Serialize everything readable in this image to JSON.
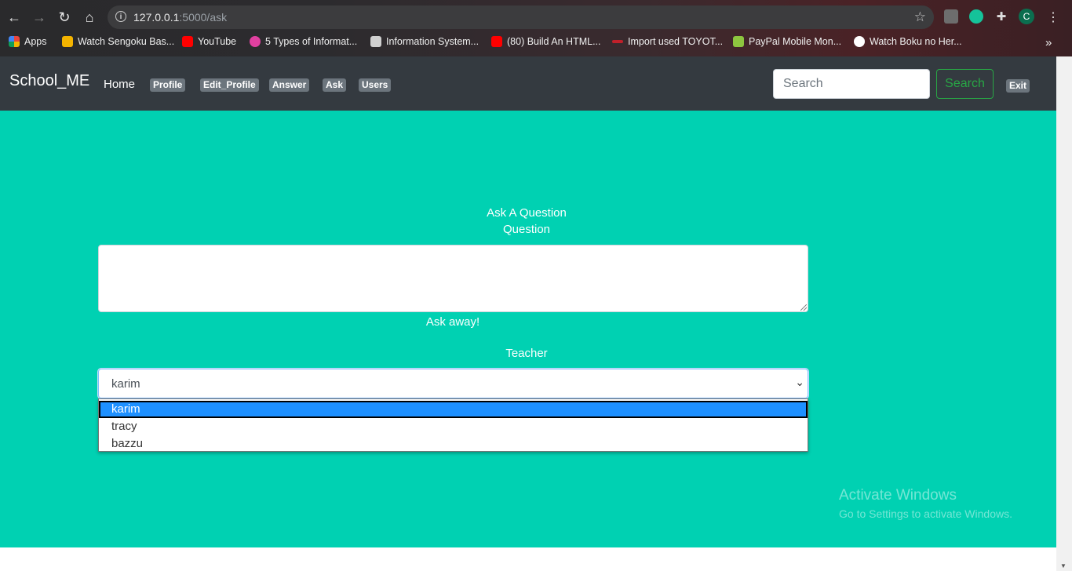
{
  "browser": {
    "url_host": "127.0.0.1",
    "url_path": ":5000/ask",
    "profile_initial": "C",
    "bookmarks": [
      {
        "label": "Apps",
        "icon": "apps-grid-icon",
        "color": "#e8453c"
      },
      {
        "label": "Watch Sengoku Bas...",
        "icon": "site-icon",
        "color": "#f4b400"
      },
      {
        "label": "YouTube",
        "icon": "youtube-icon",
        "color": "#ff0000"
      },
      {
        "label": "5 Types of Informat...",
        "icon": "site-icon",
        "color": "#e040a0"
      },
      {
        "label": "Information System...",
        "icon": "site-icon",
        "color": "#d0d0d0"
      },
      {
        "label": "(80) Build An HTML...",
        "icon": "youtube-icon",
        "color": "#ff0000"
      },
      {
        "label": "Import used TOYOT...",
        "icon": "site-icon",
        "color": "#c0202a"
      },
      {
        "label": "PayPal Mobile Mon...",
        "icon": "site-icon",
        "color": "#8dc63f"
      },
      {
        "label": "Watch Boku no Her...",
        "icon": "globe-icon",
        "color": "#ffffff"
      }
    ],
    "more_bookmarks": "»"
  },
  "navbar": {
    "brand": "School_ME",
    "home": "Home",
    "links": [
      "Profile",
      "Edit_Profile",
      "Answer",
      "Ask",
      "Users"
    ],
    "search_placeholder": "Search",
    "search_button": "Search",
    "exit": "Exit"
  },
  "form": {
    "heading": "Ask A Question",
    "question_label": "Question",
    "question_value": "",
    "helper_text": "Ask away!",
    "teacher_label": "Teacher",
    "teacher_selected": "karim",
    "teacher_options": [
      "karim",
      "tracy",
      "bazzu"
    ]
  },
  "watermark": {
    "title": "Activate Windows",
    "subtitle": "Go to Settings to activate Windows."
  },
  "colors": {
    "page_bg": "#00d1b2",
    "navbar_bg": "#343a40",
    "search_button": "#28a745",
    "badge": "#6c757d",
    "selected_option": "#1e90ff"
  }
}
